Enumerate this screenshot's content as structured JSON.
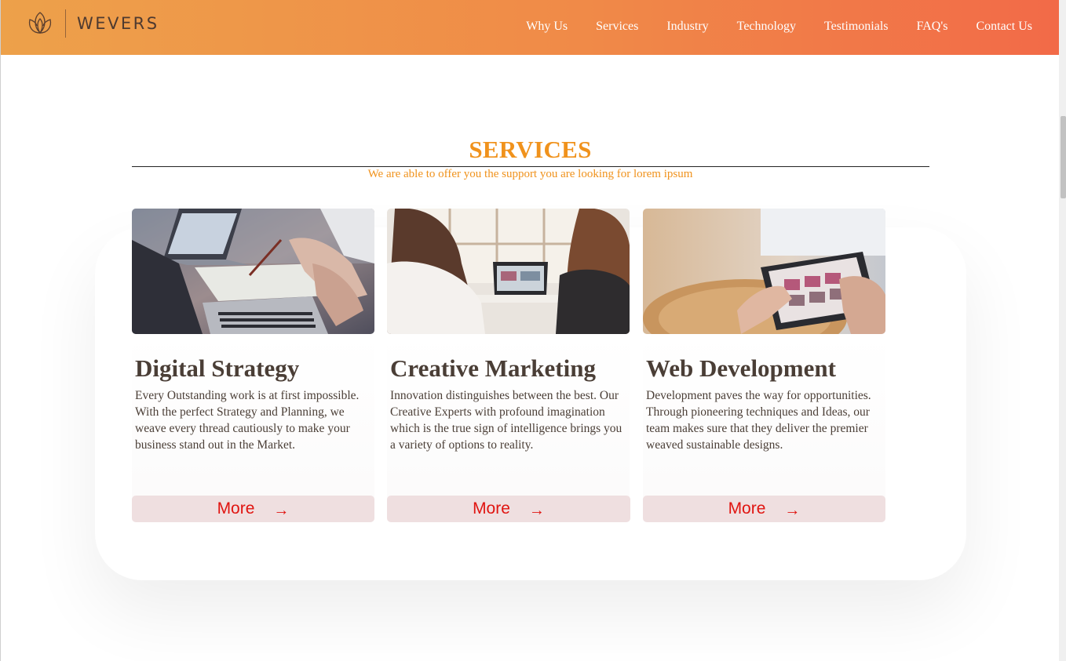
{
  "brand": {
    "name": "WEVERS"
  },
  "nav": [
    {
      "label": "Why Us"
    },
    {
      "label": "Services"
    },
    {
      "label": "Industry"
    },
    {
      "label": "Technology"
    },
    {
      "label": "Testimonials"
    },
    {
      "label": "FAQ's"
    },
    {
      "label": "Contact Us"
    }
  ],
  "section": {
    "title": "SERVICES",
    "subtitle": "We are able to offer you the support you are looking for lorem ipsum"
  },
  "cards": [
    {
      "title": "Digital Strategy",
      "text": "Every Outstanding work is at first impossible. With the perfect Strategy and Planning, we weave every thread cautiously to make your business stand out in the Market.",
      "button": "More",
      "arrow": "→"
    },
    {
      "title": "Creative Marketing",
      "text": "Innovation distinguishes between the best. Our Creative Experts with profound imagination which is the true sign of intelligence brings you a variety of options to reality.",
      "button": "More",
      "arrow": "→"
    },
    {
      "title": "Web Development",
      "text": "Development paves the way for opportunities. Through pioneering techniques and Ideas, our team makes sure that they deliver the premier weaved sustainable designs.",
      "button": "More",
      "arrow": "→"
    }
  ],
  "colors": {
    "accent": "#f0921c",
    "header_start": "#eda14a",
    "header_end": "#f26a48",
    "button_bg": "#efdfe0",
    "button_text": "#e01410"
  }
}
